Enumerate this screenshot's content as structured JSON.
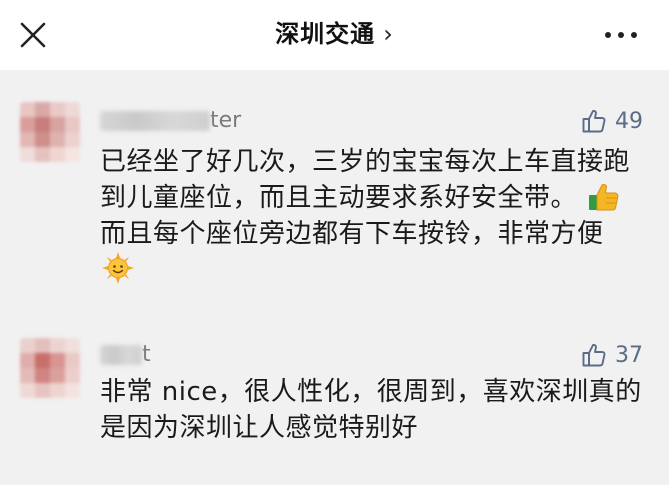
{
  "header": {
    "title": "深圳交通",
    "chevron": "›",
    "icons": {
      "close": "close-icon",
      "more": "more-dots-icon"
    }
  },
  "comments": [
    {
      "username_visible": "ter",
      "likes": "49",
      "text_before_emoji": "已经坐了好几次，三岁的宝宝每次上车直接跑到儿童座位，而且主动要求系好安全带。",
      "text_after_thumbs": "而且每个座位旁边都有下车按铃，非常方便",
      "emojis": [
        "thumbs-up-emoji",
        "sun-emoji"
      ]
    },
    {
      "username_visible": "t",
      "likes": "37",
      "text": "非常 nice，很人性化，很周到，喜欢深圳真的是因为深圳让人感觉特别好"
    }
  ],
  "colors": {
    "like_accent": "#5a6c88",
    "background": "#f1f1f1",
    "header_bg": "#ffffff"
  }
}
